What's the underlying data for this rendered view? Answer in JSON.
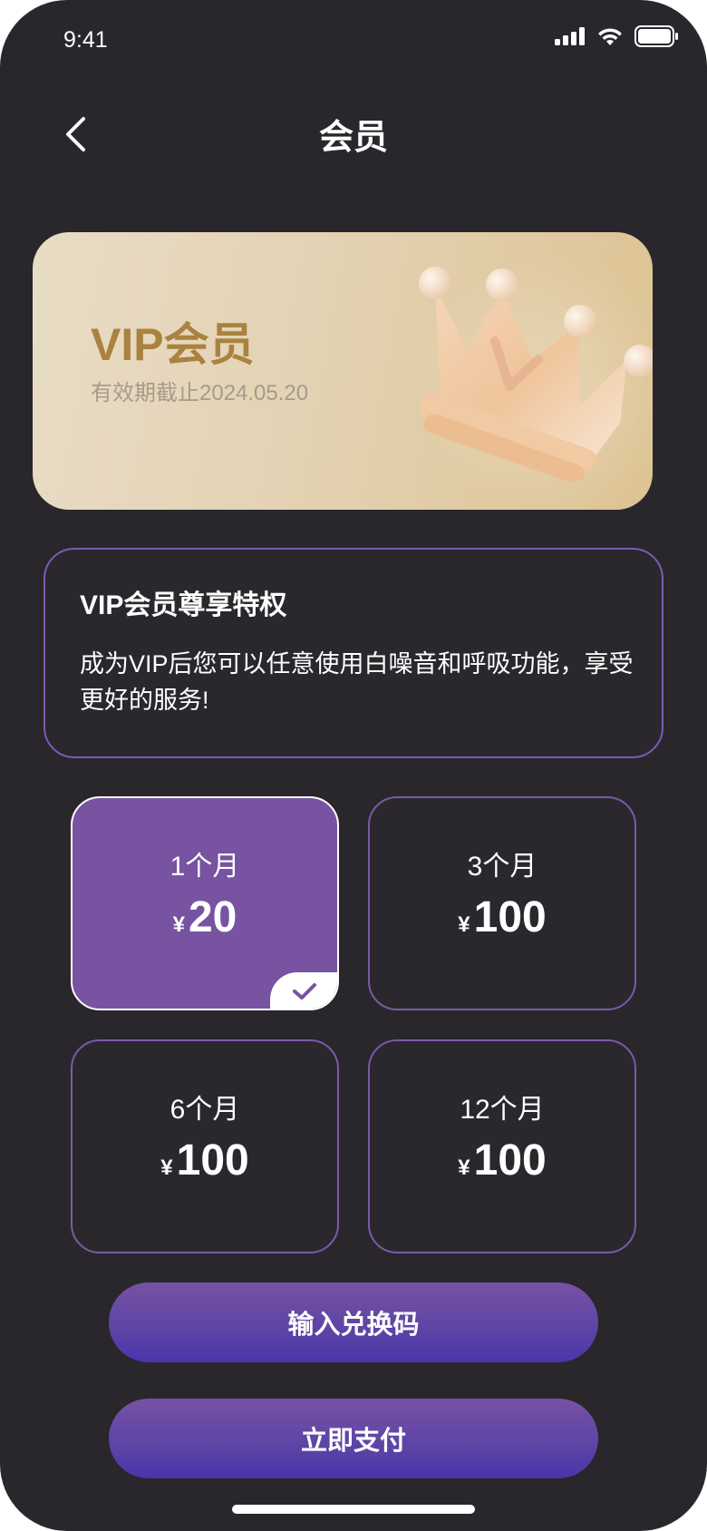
{
  "status_bar": {
    "time": "9:41"
  },
  "header": {
    "title": "会员"
  },
  "vip_card": {
    "title": "VIP会员",
    "expiry": "有效期截止2024.05.20"
  },
  "privileges": {
    "title": "VIP会员尊享特权",
    "description": "成为VIP后您可以任意使用白噪音和呼吸功能，享受更好的服务!"
  },
  "plans": [
    {
      "period": "1个月",
      "currency": "¥",
      "price": "20",
      "selected": true
    },
    {
      "period": "3个月",
      "currency": "¥",
      "price": "100",
      "selected": false
    },
    {
      "period": "6个月",
      "currency": "¥",
      "price": "100",
      "selected": false
    },
    {
      "period": "12个月",
      "currency": "¥",
      "price": "100",
      "selected": false
    }
  ],
  "buttons": {
    "redeem": "输入兑换码",
    "pay": "立即支付"
  },
  "colors": {
    "background": "#29272c",
    "accent": "#7753a2",
    "gold": "#a9823f"
  }
}
